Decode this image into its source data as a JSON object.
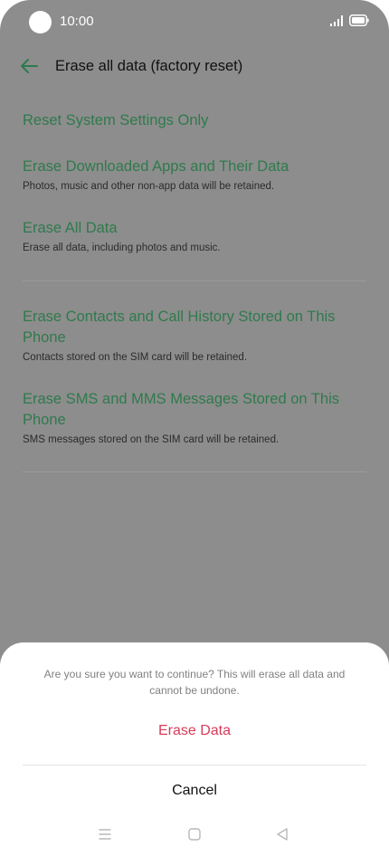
{
  "status_bar": {
    "time": "10:00",
    "icons": [
      "camera-dot",
      "signal-icon",
      "battery-icon"
    ]
  },
  "header": {
    "title": "Erase all data (factory reset)",
    "back_icon": "back-arrow-icon"
  },
  "options": [
    {
      "title": "Reset System Settings Only",
      "desc": ""
    },
    {
      "title": "Erase Downloaded Apps and Their Data",
      "desc": "Photos, music and other non-app data will be retained."
    },
    {
      "title": "Erase All Data",
      "desc": "Erase all data, including photos and music."
    },
    {
      "title": "Erase Contacts and Call History Stored on This Phone",
      "desc": "Contacts stored on the SIM card will be retained."
    },
    {
      "title": "Erase SMS and MMS Messages Stored on This Phone",
      "desc": "SMS messages stored on the SIM card will be retained."
    }
  ],
  "dialog": {
    "message": "Are you sure you want to continue? This will erase all data and cannot be undone.",
    "confirm_label": "Erase Data",
    "cancel_label": "Cancel"
  },
  "nav_bar": {
    "icons": [
      "menu-icon",
      "home-icon",
      "back-triangle-icon"
    ]
  },
  "colors": {
    "accent_green": "#2f7a4c",
    "destructive_red": "#d83c5a",
    "scrim": "#8d8d8d"
  }
}
